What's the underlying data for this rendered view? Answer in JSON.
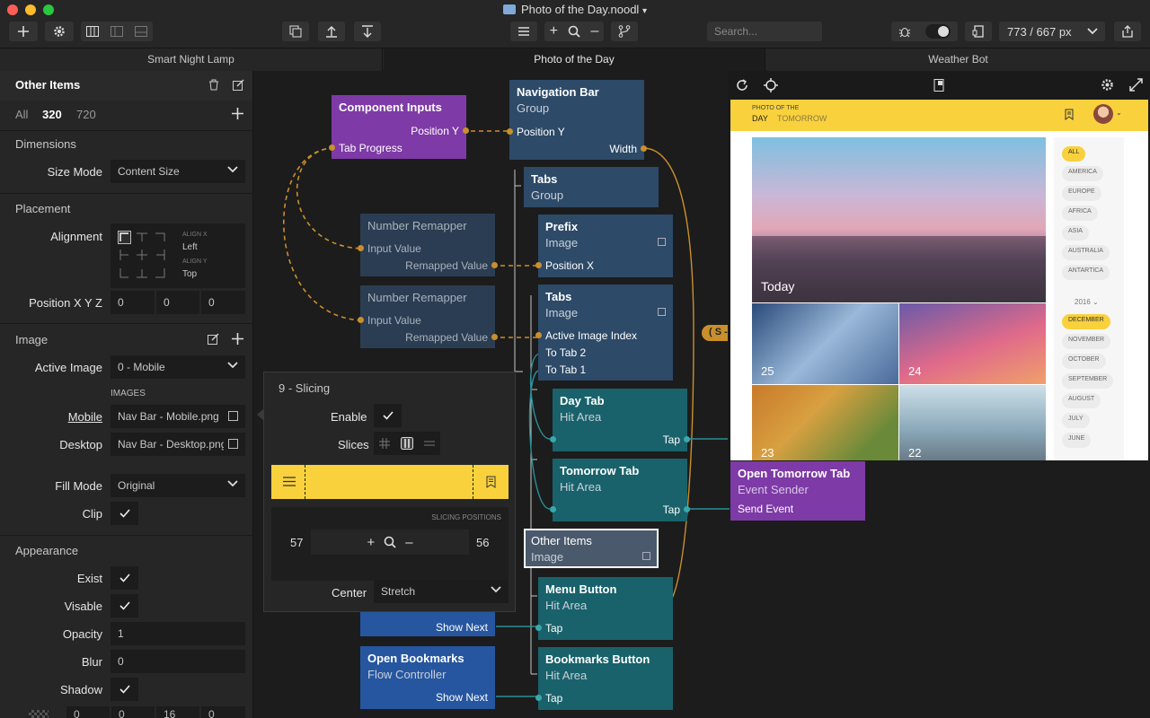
{
  "window": {
    "title": "Photo of the Day.noodl",
    "zoom": "773 / 667 px",
    "search_placeholder": "Search..."
  },
  "tabs": [
    "Smart Night Lamp",
    "Photo of the Day",
    "Weather Bot"
  ],
  "sidebar": {
    "title": "Other Items",
    "filter": {
      "all": "All",
      "w320": "320",
      "w720": "720"
    },
    "dimensions": {
      "section": "Dimensions",
      "size_mode_label": "Size Mode",
      "size_mode": "Content Size"
    },
    "placement": {
      "section": "Placement",
      "alignment_label": "Alignment",
      "align_x_label": "ALIGN X",
      "align_x": "Left",
      "align_y_label": "ALIGN Y",
      "align_y": "Top",
      "position_label": "Position X Y Z",
      "px": "0",
      "py": "0",
      "pz": "0"
    },
    "image": {
      "section": "Image",
      "active_image_label": "Active Image",
      "active_image": "0 - Mobile",
      "images_label": "IMAGES",
      "mobile_label": "Mobile",
      "mobile_value": "Nav Bar - Mobile.png",
      "desktop_label": "Desktop",
      "desktop_value": "Nav Bar - Desktop.png",
      "fill_mode_label": "Fill Mode",
      "fill_mode": "Original",
      "clip_label": "Clip"
    },
    "appearance": {
      "section": "Appearance",
      "exist_label": "Exist",
      "visable_label": "Visable",
      "opacity_label": "Opacity",
      "opacity": "1",
      "blur_label": "Blur",
      "blur": "0",
      "shadow_label": "Shadow",
      "shadow_vals": [
        "0",
        "0",
        "16",
        "0"
      ]
    }
  },
  "nodes": {
    "component_inputs": {
      "title": "Component Inputs",
      "p1": "Position Y",
      "p2": "Tab Progress"
    },
    "nav_bar": {
      "title": "Navigation Bar",
      "sub": "Group",
      "p1": "Position Y",
      "p2": "Width"
    },
    "tabs_group": {
      "title": "Tabs",
      "sub": "Group"
    },
    "remapper1": {
      "title": "Number Remapper",
      "p1": "Input Value",
      "p2": "Remapped Value"
    },
    "remapper2": {
      "title": "Number Remapper",
      "p1": "Input Value",
      "p2": "Remapped Value"
    },
    "prefix": {
      "title": "Prefix",
      "sub": "Image",
      "p1": "Position X"
    },
    "tabs_image": {
      "title": "Tabs",
      "sub": "Image",
      "p1": "Active Image Index",
      "p2": "To Tab 2",
      "p3": "To Tab 1"
    },
    "day_tab": {
      "title": "Day Tab",
      "sub": "Hit Area",
      "p1": "Tap"
    },
    "tomorrow_tab": {
      "title": "Tomorrow Tab",
      "sub": "Hit Area",
      "p1": "Tap"
    },
    "open_tomorrow": {
      "title": "Open Tomorrow Tab",
      "sub": "Event Sender",
      "p1": "Send Event"
    },
    "other_items": {
      "title": "Other Items",
      "sub": "Image"
    },
    "menu_button": {
      "title": "Menu Button",
      "sub": "Hit Area",
      "p1": "Tap"
    },
    "hidden_node": {
      "p1": "Show Next"
    },
    "open_bookmarks": {
      "title": "Open Bookmarks",
      "sub": "Flow Controller",
      "p1": "Show Next"
    },
    "bookmarks_button": {
      "title": "Bookmarks Button",
      "sub": "Hit Area",
      "p1": "Tap"
    },
    "badge": "( S -"
  },
  "slicing": {
    "title": "9 - Slicing",
    "enable_label": "Enable",
    "slices_label": "Slices",
    "positions_label": "SLICING POSITIONS",
    "left": "57",
    "right": "56",
    "center_label": "Center",
    "center": "Stretch"
  },
  "preview": {
    "header_small": "PHOTO OF THE",
    "tab_day": "DAY",
    "tab_tomorrow": "TOMORROW",
    "today": "Today",
    "tiles": [
      "25",
      "24",
      "23",
      "22"
    ],
    "filters": [
      "ALL",
      "AMERICA",
      "EUROPE",
      "AFRICA",
      "ASIA",
      "AUSTRALIA",
      "ANTARTICA"
    ],
    "year": "2016",
    "months": [
      "DECEMBER",
      "NOVEMBER",
      "OCTOBER",
      "SEPTEMBER",
      "AUGUST",
      "JULY",
      "JUNE"
    ]
  },
  "colors": {
    "accent": "#f8d13d",
    "purple": "#7e3aa6",
    "teal": "#19626b",
    "navy": "#2d4a68",
    "blue": "#2656a0",
    "orange_wire": "#c98f2c"
  }
}
